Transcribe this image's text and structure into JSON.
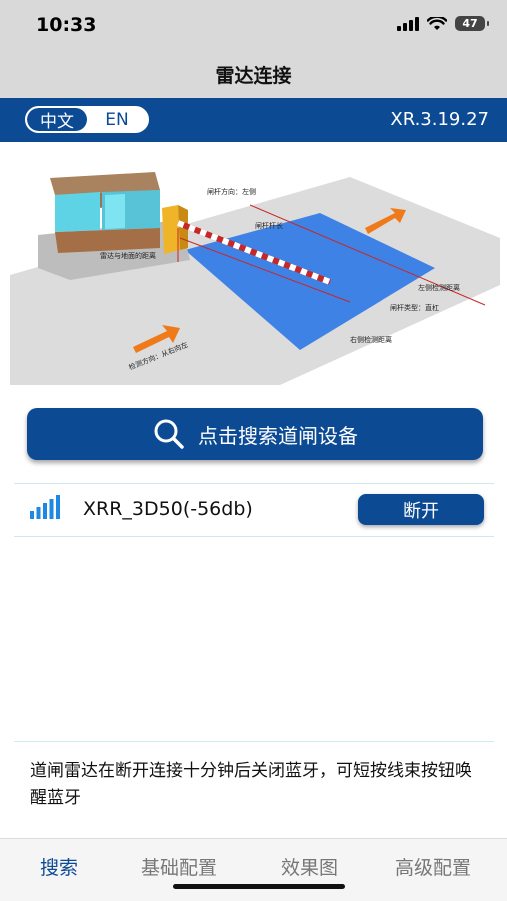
{
  "status_bar": {
    "time": "10:33",
    "battery": "47",
    "icons": [
      "signal-bars-icon",
      "wifi-icon",
      "battery-icon"
    ]
  },
  "nav": {
    "title": "雷达连接"
  },
  "header": {
    "lang_options": [
      "中文",
      "EN"
    ],
    "active_lang": "中文",
    "version": "XR.3.19.27",
    "color": "#0c4a94"
  },
  "illustration": {
    "labels": {
      "boom_direction": "闸杆方向：左侧",
      "boom_length": "闸杆杆长",
      "radar_ground": "雷达与地面的距离",
      "left_distance": "左侧检测距离",
      "boom_type": "闸杆类型：直杠",
      "right_distance": "右侧检测距离",
      "detect_direction": "检测方向：从右向左"
    }
  },
  "search": {
    "label": "点击搜索道闸设备",
    "icon": "search-icon"
  },
  "device": {
    "name": "XRR_3D50(-56db)",
    "button_label": "断开",
    "icon": "signal-strength-icon"
  },
  "notice": {
    "text": "道闸雷达在断开连接十分钟后关闭蓝牙，可短按线束按钮唤醒蓝牙"
  },
  "tabs": [
    {
      "label": "搜索",
      "active": true
    },
    {
      "label": "基础配置",
      "active": false
    },
    {
      "label": "效果图",
      "active": false
    },
    {
      "label": "高级配置",
      "active": false
    }
  ]
}
